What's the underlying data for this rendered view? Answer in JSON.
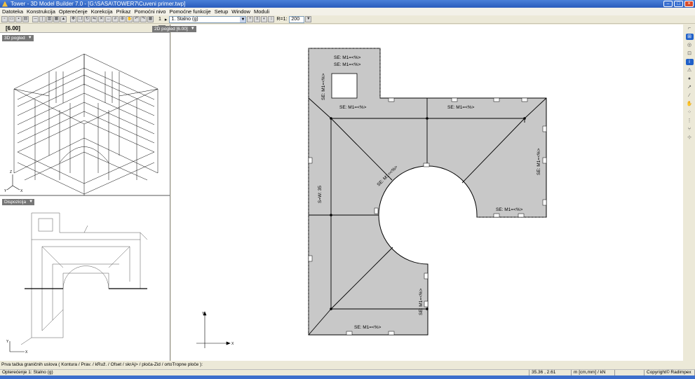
{
  "window": {
    "title": "Tower - 3D Model Builder 7.0 - [G:\\SASA\\TOWER7\\Cuveni primer.twp]"
  },
  "menu": [
    "Datoteka",
    "Konstrukcija",
    "Opterećenje",
    "Korekcija",
    "Prikaz",
    "Pomoćni nivo",
    "Pomoćne funkcije",
    "Setup",
    "Window",
    "Moduli"
  ],
  "toolbar": {
    "level_indicator": "1",
    "load_case_select": "1. Stalno (g)",
    "radius_label": "R=1:",
    "radius_value": "200"
  },
  "left_panel": {
    "level": "[6.00]",
    "view_3d_label": "3D pogled",
    "view_disp_label": "Dispozicija"
  },
  "main_view": {
    "view_label": "2D pogled [6.00]",
    "x_axis": "X",
    "y_axis": "Y",
    "slab_labels": [
      "SE: M1=<%>",
      "SE: M1=<%>",
      "SE: M1=<%>",
      "SE: M1=<%>",
      "SE: M1=<%>",
      "SE: M1=<%>",
      "SE: M1=<%>",
      "SE: M1=<%>",
      "SE: M1=<%>",
      "SE: M1=<%>"
    ],
    "wall_label": "S=W: 35"
  },
  "cmdline": "Prva tačka graničnih uslova ( Kontura / Prav. / kRuž. / Ofset / skrAj> / ploča-Zid / ortoTropne ploče ):",
  "status": {
    "load_case": "Opterećenje 1: Stalno (g)",
    "coords": "35.36 , 2.61",
    "units": "m [cm,mm] / kN",
    "copyright": "Copyright© Radimpex"
  }
}
